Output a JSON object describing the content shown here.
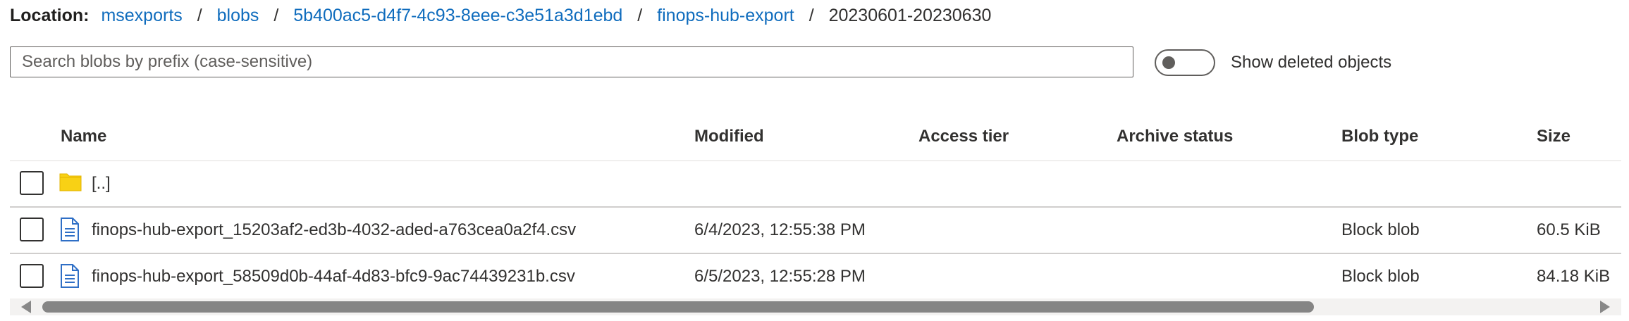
{
  "location": {
    "label": "Location:",
    "crumbs": [
      "msexports",
      "blobs",
      "5b400ac5-d4f7-4c93-8eee-c3e51a3d1ebd",
      "finops-hub-export"
    ],
    "current": "20230601-20230630",
    "separator": "/"
  },
  "search": {
    "placeholder": "Search blobs by prefix (case-sensitive)",
    "value": ""
  },
  "toggle": {
    "label": "Show deleted objects",
    "on": false
  },
  "columns": {
    "name": "Name",
    "modified": "Modified",
    "access_tier": "Access tier",
    "archive_status": "Archive status",
    "blob_type": "Blob type",
    "size": "Size"
  },
  "rows": [
    {
      "icon": "folder-icon",
      "name": "[..]",
      "modified": "",
      "access_tier": "",
      "archive_status": "",
      "blob_type": "",
      "size": ""
    },
    {
      "icon": "file-icon",
      "name": "finops-hub-export_15203af2-ed3b-4032-aded-a763cea0a2f4.csv",
      "modified": "6/4/2023, 12:55:38 PM",
      "access_tier": "",
      "archive_status": "",
      "blob_type": "Block blob",
      "size": "60.5 KiB"
    },
    {
      "icon": "file-icon",
      "name": "finops-hub-export_58509d0b-44af-4d83-bfc9-9ac74439231b.csv",
      "modified": "6/5/2023, 12:55:28 PM",
      "access_tier": "",
      "archive_status": "",
      "blob_type": "Block blob",
      "size": "84.18 KiB"
    }
  ],
  "colors": {
    "link": "#0f6cbd",
    "folder": "#f8d115",
    "file": "#2f6fc6"
  }
}
